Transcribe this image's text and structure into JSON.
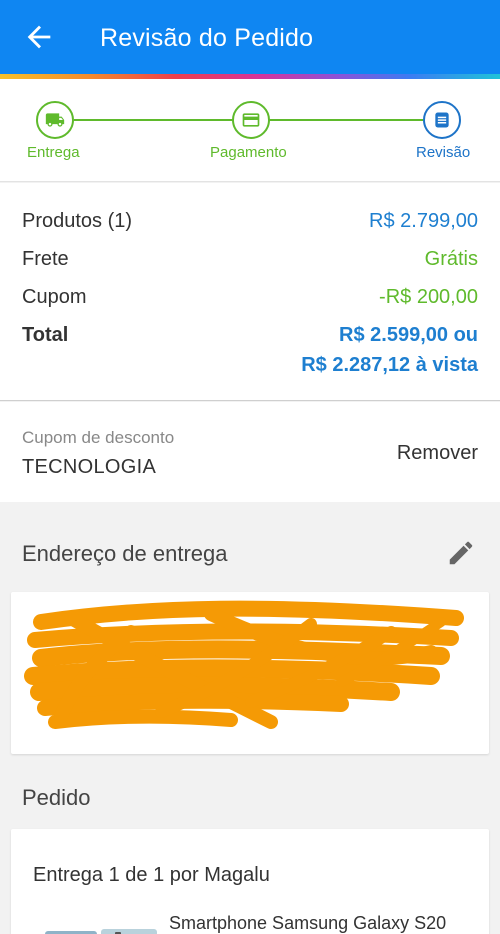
{
  "header": {
    "title": "Revisão do Pedido"
  },
  "steps": [
    {
      "label": "Entrega"
    },
    {
      "label": "Pagamento"
    },
    {
      "label": "Revisão"
    }
  ],
  "summary": {
    "products_label": "Produtos (1)",
    "products_value": "R$ 2.799,00",
    "shipping_label": "Frete",
    "shipping_value": "Grátis",
    "coupon_label": "Cupom",
    "coupon_value": "-R$ 200,00",
    "total_label": "Total",
    "total_value": "R$ 2.599,00 ou",
    "total_cash": "R$ 2.287,12 à vista"
  },
  "coupon": {
    "caption": "Cupom de desconto",
    "code": "TECNOLOGIA",
    "remove_label": "Remover"
  },
  "address": {
    "title": "Endereço de entrega"
  },
  "order": {
    "title": "Pedido",
    "delivery": "Entrega 1 de 1 por Magalu",
    "product_name": "Smartphone Samsung Galaxy S20"
  },
  "colors": {
    "app_bar": "#0f86f2",
    "step_done": "#5fba2c",
    "step_current": "#1e74c8",
    "price_blue": "#1e7fd0",
    "discount_green": "#5fba2c",
    "redaction": "#f59a05"
  }
}
